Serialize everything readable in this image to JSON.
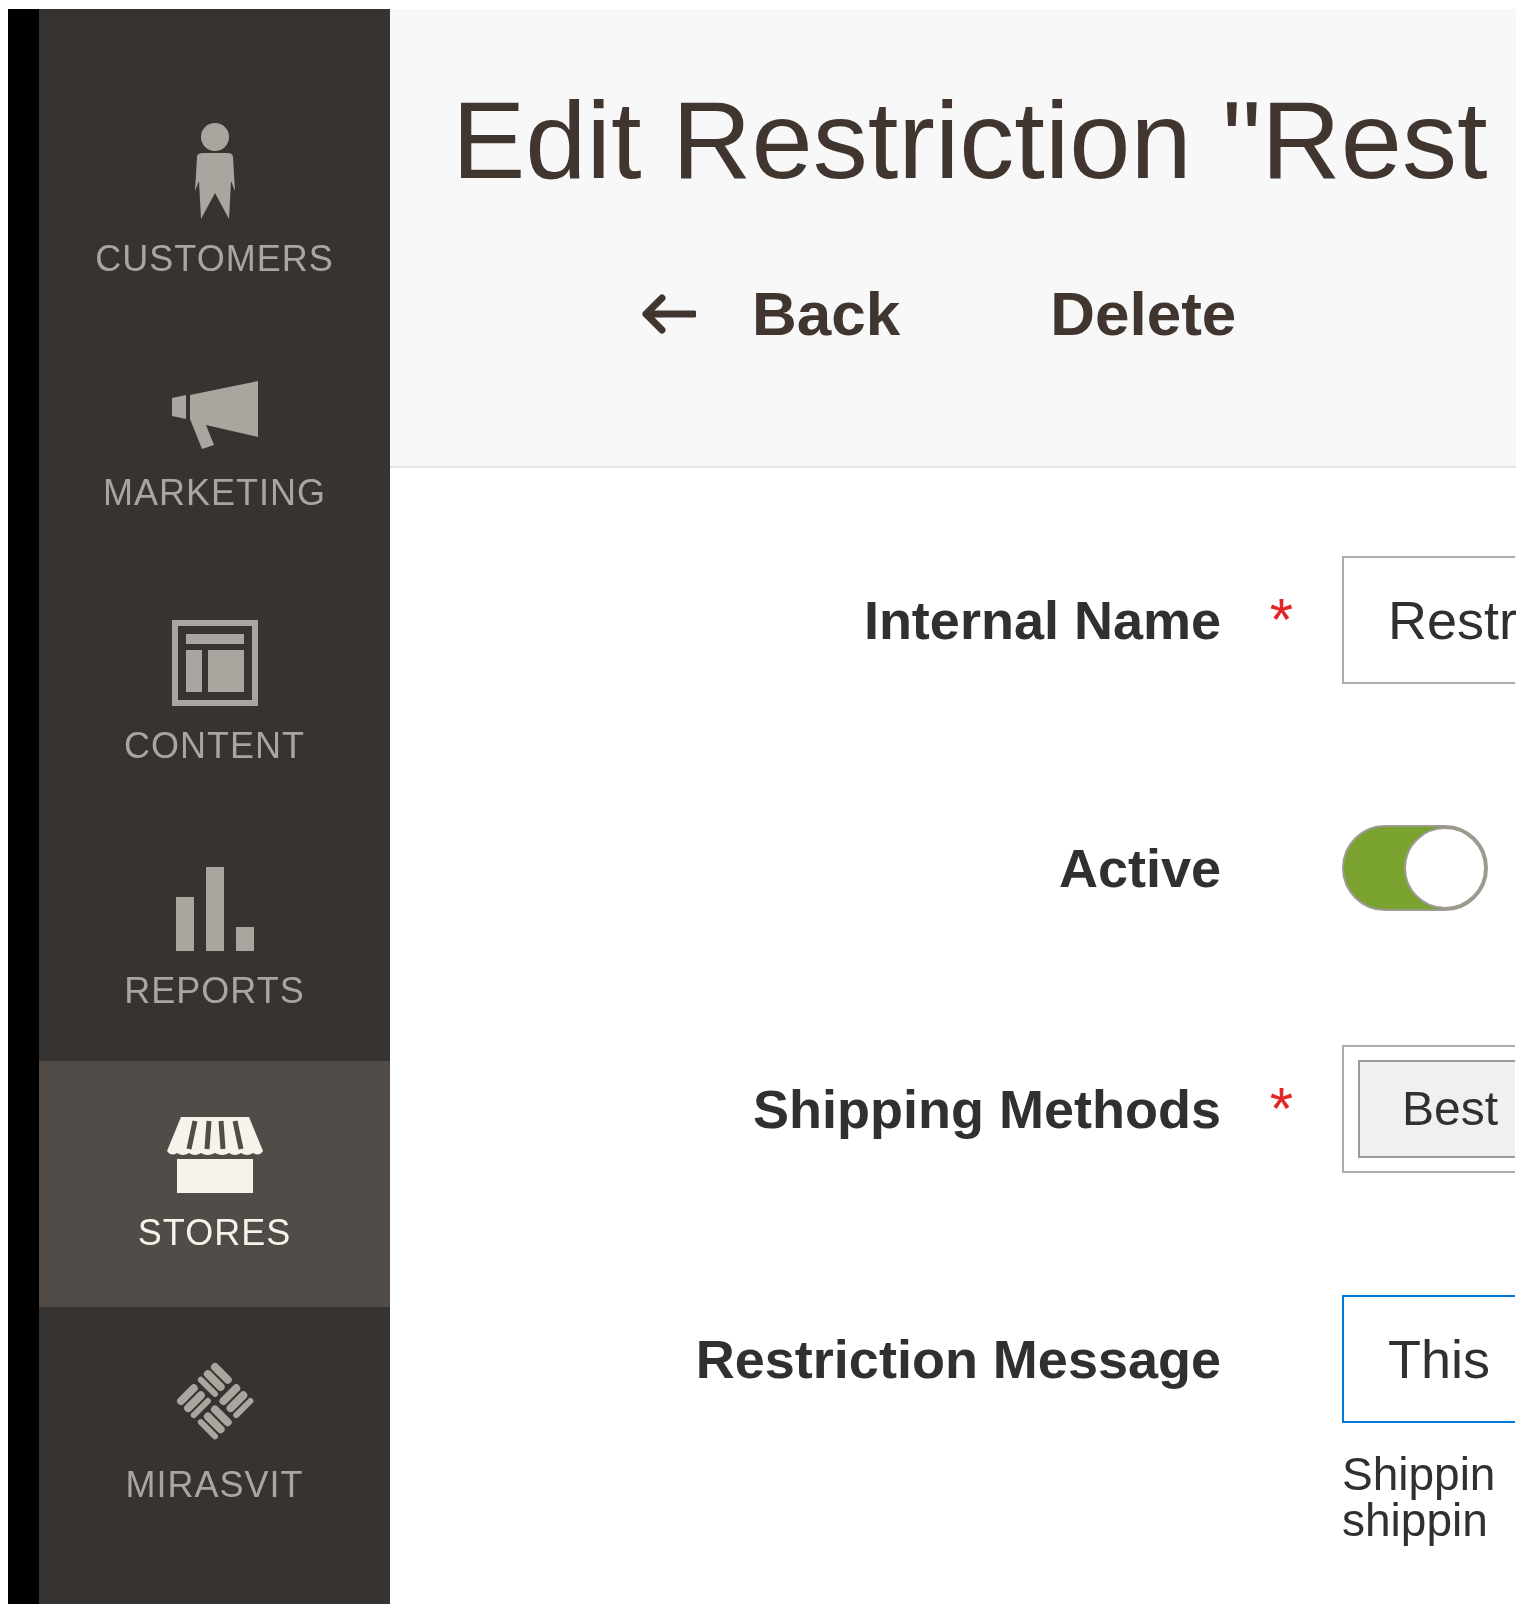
{
  "sidebar": {
    "items": [
      {
        "label": "CUSTOMERS",
        "kind": "customers",
        "selected": false
      },
      {
        "label": "MARKETING",
        "kind": "marketing",
        "selected": false
      },
      {
        "label": "CONTENT",
        "kind": "content",
        "selected": false
      },
      {
        "label": "REPORTS",
        "kind": "reports",
        "selected": false
      },
      {
        "label": "STORES",
        "kind": "stores",
        "selected": true
      },
      {
        "label": "MIRASVIT",
        "kind": "mirasvit",
        "selected": false
      }
    ]
  },
  "page": {
    "title": "Edit Restriction \"Rest",
    "actions": [
      {
        "label": "Back",
        "kind": "back"
      },
      {
        "label": "Delete",
        "kind": "plain"
      }
    ]
  },
  "form": {
    "fields": [
      {
        "kind": "text",
        "label": "Internal Name",
        "required_mark": "*",
        "focused": false,
        "value": "Restr"
      },
      {
        "kind": "toggle",
        "label": "Active",
        "on": true
      },
      {
        "kind": "multiselect",
        "label": "Shipping Methods",
        "required_mark": "*",
        "chips": [
          "Best"
        ]
      },
      {
        "kind": "text",
        "label": "Restriction Message",
        "focused": true,
        "value": "This",
        "note": [
          "Shippin",
          "shippin"
        ]
      }
    ]
  }
}
